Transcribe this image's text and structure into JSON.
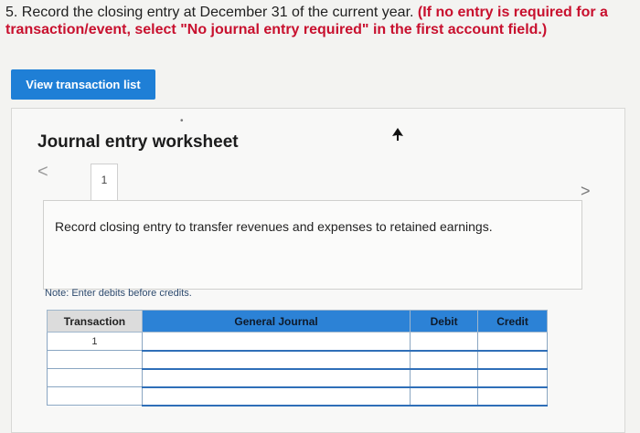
{
  "question": {
    "prefix": "5. Record the closing entry at December 31 of the current year. ",
    "instruction": "(If no entry is required for a transaction/event, select \"No journal entry required\" in the first account field.)"
  },
  "view_button": {
    "label": "View transaction list"
  },
  "worksheet": {
    "title": "Journal entry worksheet",
    "tab_number": "1",
    "description": "Record closing entry to transfer revenues and expenses to retained earnings.",
    "note": "Note: Enter debits before credits.",
    "prev_glyph": "<",
    "next_glyph": ">"
  },
  "table": {
    "headers": {
      "transaction": "Transaction",
      "journal": "General Journal",
      "debit": "Debit",
      "credit": "Credit"
    },
    "rows": [
      {
        "transaction": "1"
      },
      {
        "transaction": ""
      },
      {
        "transaction": ""
      },
      {
        "transaction": ""
      }
    ]
  },
  "colors": {
    "accent": "#1f7fd6",
    "header_blue": "#2c82d6",
    "instruction_red": "#c8102e"
  }
}
